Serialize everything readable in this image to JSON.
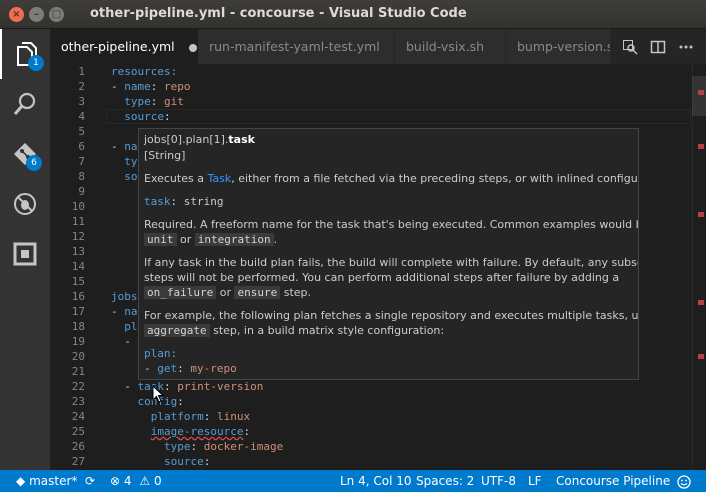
{
  "window": {
    "title": "other-pipeline.yml - concourse - Visual Studio Code",
    "close_glyph": "×",
    "minimize_glyph": "–",
    "maximize_glyph": "□"
  },
  "activity_bar": {
    "explorer_badge": "1",
    "git_badge": "6",
    "icons": [
      "files-icon",
      "search-icon",
      "source-control-icon",
      "debug-icon",
      "extensions-icon"
    ]
  },
  "tabs": [
    {
      "label": "other-pipeline.yml",
      "active": true,
      "dirty": true
    },
    {
      "label": "run-manifest-yaml-test.yml",
      "active": false
    },
    {
      "label": "build-vsix.sh",
      "active": false
    },
    {
      "label": "bump-version.s",
      "active": false
    }
  ],
  "editor": {
    "line_numbers": [
      "1",
      "2",
      "3",
      "4",
      "5",
      "6",
      "7",
      "8",
      "9",
      "10",
      "11",
      "12",
      "13",
      "14",
      "15",
      "16",
      "17",
      "18",
      "19",
      "20",
      "21",
      "22",
      "23",
      "24",
      "25",
      "26",
      "27"
    ],
    "lines": {
      "l1": "resources:",
      "l2_dash": "- ",
      "l2_key": "name",
      "l2_val": "repo",
      "l3_key": "type",
      "l3_val": "git",
      "l4_key": "source",
      "l6_dash": "- ",
      "l6_key": "na",
      "l7_key": "ty",
      "l8_key": "so",
      "l16_key": "jobs",
      "l17_dash": "- ",
      "l17_key": "na",
      "l18_key": "pl",
      "l19_dash": "- ",
      "l22_dash": "- ",
      "l22_key": "task",
      "l22_val": "print-version",
      "l23_key": "config",
      "l24_key": "platform",
      "l24_val": "linux",
      "l25_key": "image-resource",
      "l26_key": "type",
      "l26_val": "docker-image",
      "l27_key": "source"
    }
  },
  "hover": {
    "path_prefix": "jobs[0].plan[1].",
    "path_field": "task",
    "type": "[String]",
    "desc_pre": "Executes a ",
    "desc_link": "Task",
    "desc_post": ", either from a file fetched via the preceding steps, or with inlined configuration.",
    "sig_key": "task",
    "sig_type": "string",
    "req_line1": "Required. A freeform name for the task that's being executed. Common examples would be",
    "req_code1": "unit",
    "req_or": " or ",
    "req_code2": "integration",
    "req_end": ".",
    "fail_line1": "If any task in the build plan fails, the build will complete with failure. By default, any subsequent",
    "fail_line2": "steps will not be performed. You can perform additional steps after failure by adding a",
    "fail_code1": "on_failure",
    "fail_or": " or ",
    "fail_code2": "ensure",
    "fail_end": " step.",
    "ex_line1": "For example, the following plan fetches a single repository and executes multiple tasks, using the",
    "ex_code": "aggregate",
    "ex_end": " step, in a build matrix style configuration:",
    "code_plan": "plan:",
    "code_dash": "- ",
    "code_get": "get",
    "code_repo": "my-repo"
  },
  "status_bar": {
    "branch": "master*",
    "errors": "4",
    "warnings": "0",
    "position": "Ln 4, Col 10",
    "spaces": "Spaces: 2",
    "encoding": "UTF-8",
    "eol": "LF",
    "language": "Concourse Pipeline",
    "feedback_icon": "smiley-icon"
  },
  "colors": {
    "accent": "#007acc",
    "keyword": "#569cd6",
    "string": "#ce9178",
    "error": "#f14c4c"
  }
}
